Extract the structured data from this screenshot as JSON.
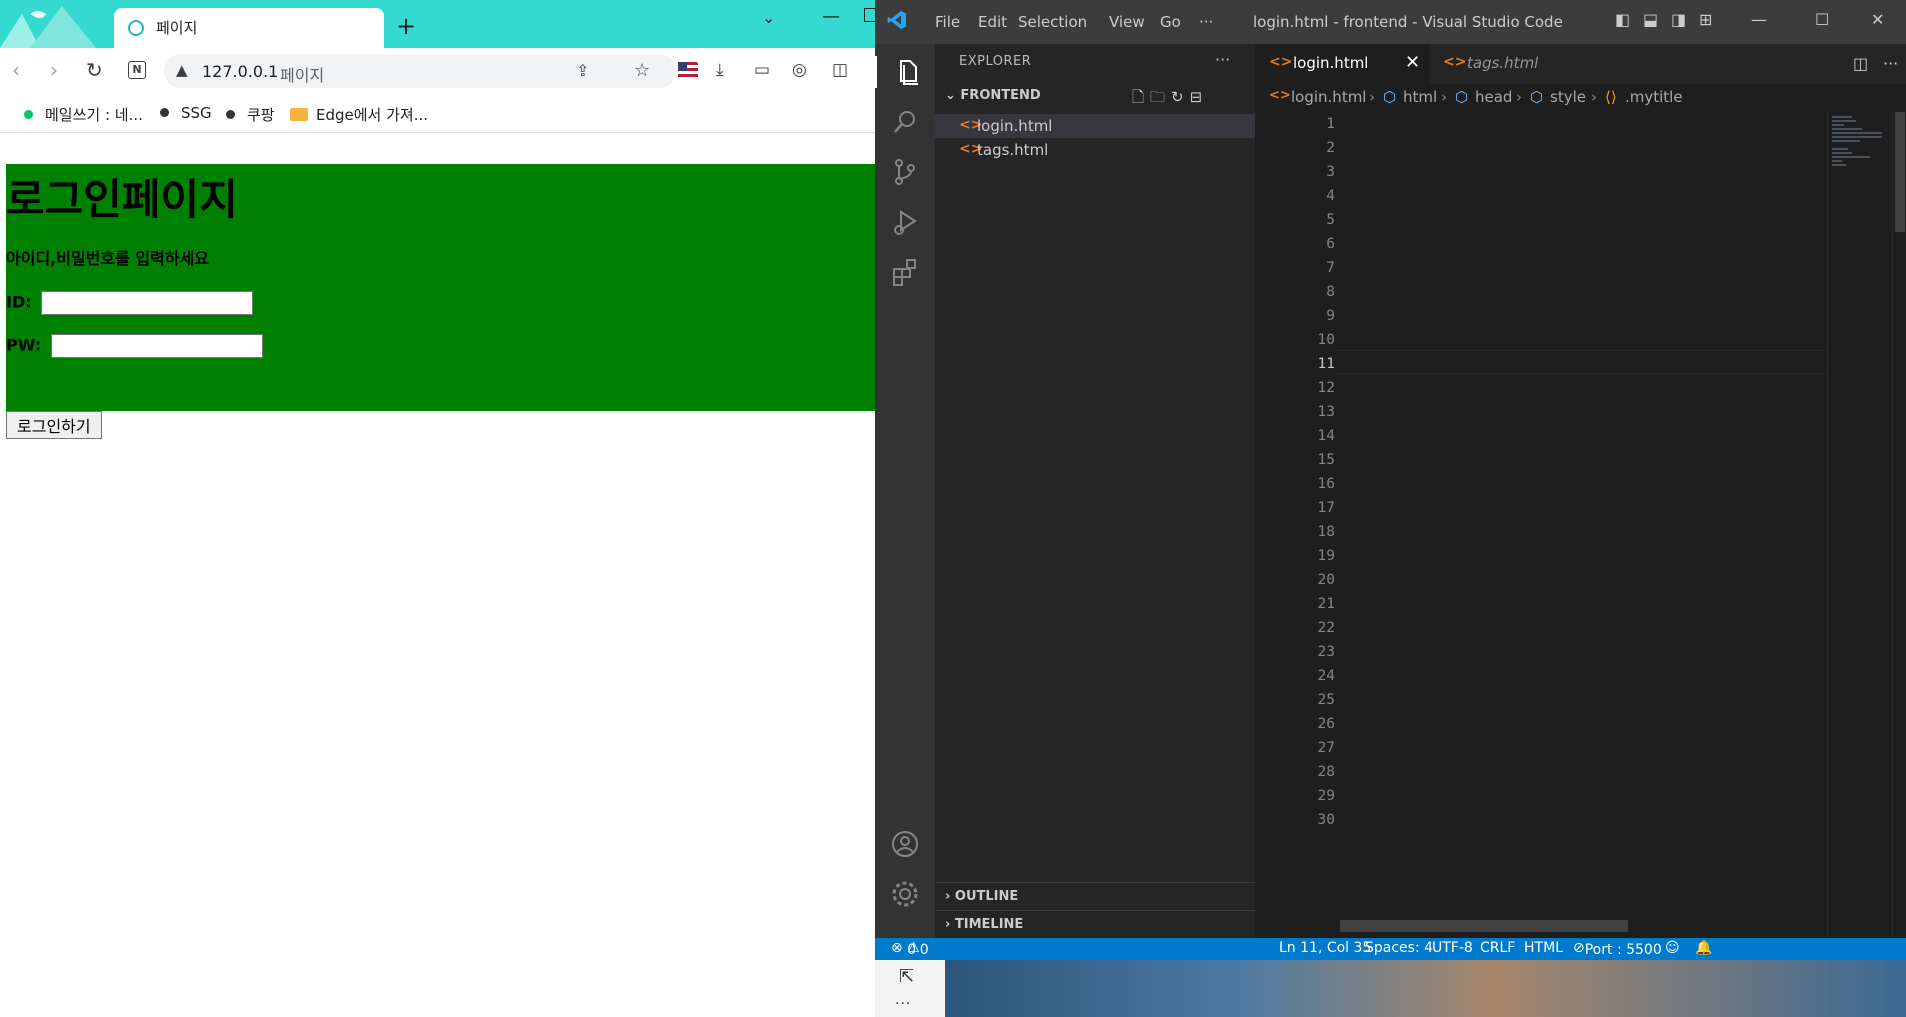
{
  "browser": {
    "tab_title": "페이지",
    "url_host": "127.0.0.1",
    "url_path": "페이지",
    "bookmarks": [
      {
        "label": "메일쓰기 : 네...",
        "color": "#03c75a"
      },
      {
        "label": "SSG",
        "color": "#333333"
      },
      {
        "label": "쿠팡",
        "color": "#333333"
      },
      {
        "label": "Edge에서 가져...",
        "color": "#f2b43b"
      }
    ],
    "page": {
      "h1": "로그인페이지",
      "h5": "아이디,비밀번호를 입력하세요",
      "id_label": "ID:",
      "pw_label": "PW:",
      "id_value": "",
      "pw_value": "",
      "button_label": "로그인하기",
      "title_bg": "#008000"
    }
  },
  "vscode": {
    "menu": [
      "File",
      "Edit",
      "Selection",
      "View",
      "Go",
      "···"
    ],
    "window_title": "login.html - frontend - Visual Studio Code",
    "explorer_title": "EXPLORER",
    "folder_name": "FRONTEND",
    "files": [
      "login.html",
      "tags.html"
    ],
    "outline_label": "OUTLINE",
    "timeline_label": "TIMELINE",
    "tabs": [
      {
        "label": "login.html",
        "active": true
      },
      {
        "label": "tags.html",
        "active": false
      }
    ],
    "breadcrumb": [
      "login.html",
      "html",
      "head",
      "style",
      ".mytitle"
    ],
    "current_line": 11,
    "status": {
      "problems_errors": "0",
      "problems_warnings": "0",
      "position": "Ln 11, Col 35",
      "spaces": "Spaces: 4",
      "encoding": "UTF-8",
      "eol": "CRLF",
      "language": "HTML",
      "port": "Port : 5500"
    }
  }
}
